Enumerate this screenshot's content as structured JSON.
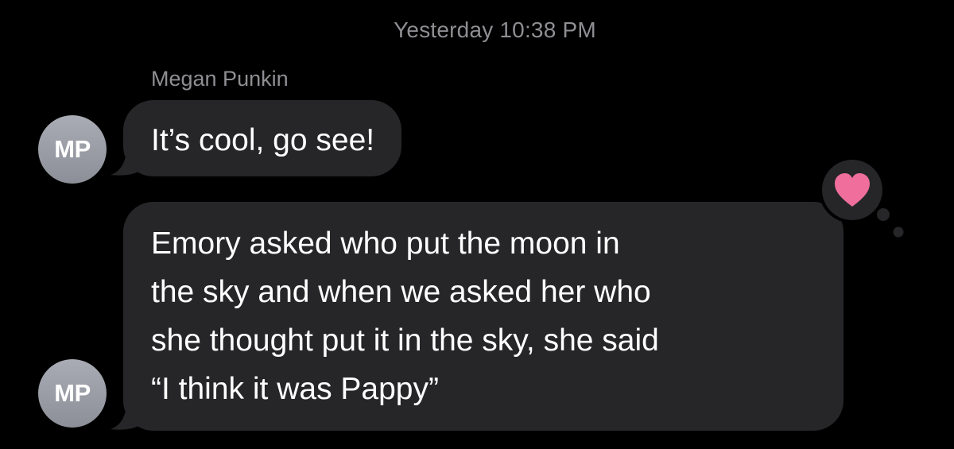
{
  "conversation": {
    "timestamp": "Yesterday 10:38 PM",
    "sender_name": "Megan Punkin",
    "avatar_initials": "MP"
  },
  "messages": [
    {
      "sender_initials": "MP",
      "lines": [
        "It’s cool, go see!"
      ]
    },
    {
      "sender_initials": "MP",
      "lines": [
        "Emory asked who put the moon in",
        "the sky and when we asked her who",
        "she thought put it in the sky, she said",
        "“I think it was Pappy”"
      ],
      "tapback": "heart-icon"
    }
  ],
  "colors": {
    "background": "#000000",
    "bubble": "#262628",
    "meta_text": "#8e8e93",
    "avatar": "#9a9da5",
    "heart": "#f06e9b",
    "tapback_bg": "#262628"
  }
}
